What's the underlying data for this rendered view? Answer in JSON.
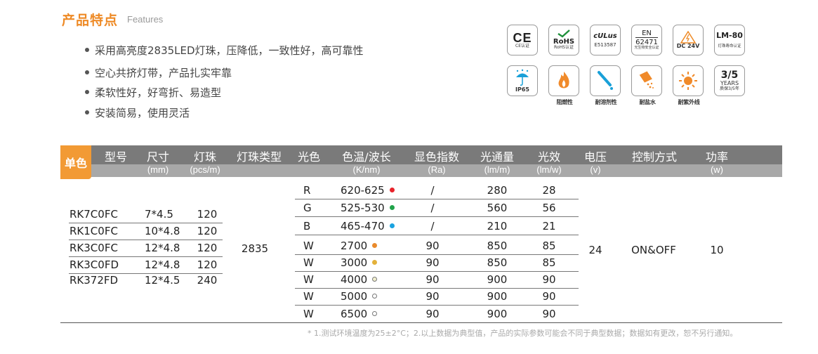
{
  "header": {
    "title": "产品特点",
    "title_en": "Features"
  },
  "features": [
    "采用高亮度2835LED灯珠，压降低，一致性好，高可靠性",
    "空心共挤灯带，产品扎实牢靠",
    "柔软性好，好弯折、易造型",
    "安装简易，使用灵活"
  ],
  "certs_row1": [
    {
      "main": "CE",
      "caption": "CE认证",
      "icon": "ce-mark-icon"
    },
    {
      "main": "RoHS",
      "caption": "RoHS认证",
      "icon": "rohs-check-icon"
    },
    {
      "main": "cULus",
      "caption": "E513587",
      "icon": "ul-mark-icon"
    },
    {
      "top": "EN",
      "main": "62471",
      "caption": "光生物安全认证",
      "icon": "en-standard-icon"
    },
    {
      "main": "DC 24V",
      "icon": "voltage-warning-icon"
    },
    {
      "main": "LM-80",
      "caption": "灯珠寿命认证",
      "icon": "lm80-icon"
    }
  ],
  "certs_row2": [
    {
      "caption": "IP65",
      "icon": "umbrella-rain-icon"
    },
    {
      "caption": "阻燃性",
      "icon": "flame-icon"
    },
    {
      "caption": "耐溶剂性",
      "icon": "dropper-icon"
    },
    {
      "caption": "耐盐水",
      "icon": "salt-water-icon"
    },
    {
      "caption": "耐紫外线",
      "icon": "sun-icon"
    },
    {
      "main": "3/5",
      "sub": "YEARS",
      "caption": "质保3/5年",
      "icon": "warranty-icon"
    }
  ],
  "table": {
    "tab_label": "单色",
    "headers": [
      {
        "label": "型号",
        "unit": ""
      },
      {
        "label": "尺寸",
        "unit": "(mm)"
      },
      {
        "label": "灯珠",
        "unit": "(pcs/m)"
      },
      {
        "label": "灯珠类型",
        "unit": ""
      },
      {
        "label": "光色",
        "unit": ""
      },
      {
        "label": "色温/波长",
        "unit": "(K/nm)"
      },
      {
        "label": "显色指数",
        "unit": "(Ra)"
      },
      {
        "label": "光通量",
        "unit": "(lm/m)"
      },
      {
        "label": "光效",
        "unit": "(lm/w)"
      },
      {
        "label": "电压",
        "unit": "(v)"
      },
      {
        "label": "控制方式",
        "unit": ""
      },
      {
        "label": "功率",
        "unit": "(w)"
      }
    ],
    "models": [
      {
        "model": "RK7C0FC",
        "size": "7*4.5",
        "leds": "120"
      },
      {
        "model": "RK1C0FC",
        "size": "10*4.8",
        "leds": "120"
      },
      {
        "model": "RK3C0FC",
        "size": "12*4.8",
        "leds": "120"
      },
      {
        "model": "RK3C0FD",
        "size": "12*4.8",
        "leds": "120"
      },
      {
        "model": "RK372FD",
        "size": "12*4.5",
        "leds": "240"
      }
    ],
    "led_type": "2835",
    "voltage": "24",
    "control": "ON&OFF",
    "power": "10",
    "colors": [
      {
        "color": "R",
        "cct": "620-625",
        "dot": "#e8232a",
        "ra": "/",
        "flux": "280",
        "eff": "28"
      },
      {
        "color": "G",
        "cct": "525-530",
        "dot": "#21a34a",
        "ra": "/",
        "flux": "560",
        "eff": "56"
      },
      {
        "color": "B",
        "cct": "465-470",
        "dot": "#1aa3e0",
        "ra": "/",
        "flux": "210",
        "eff": "21"
      },
      {
        "color": "W",
        "cct": "2700",
        "dot": "#e98a2c",
        "ra": "90",
        "flux": "850",
        "eff": "85"
      },
      {
        "color": "W",
        "cct": "3000",
        "dot": "#e3b13a",
        "ra": "90",
        "flux": "850",
        "eff": "85"
      },
      {
        "color": "W",
        "cct": "4000",
        "dot": "#f2f0cf",
        "ra": "90",
        "flux": "900",
        "eff": "90"
      },
      {
        "color": "W",
        "cct": "5000",
        "dot": "#ffffff",
        "ra": "90",
        "flux": "900",
        "eff": "90"
      },
      {
        "color": "W",
        "cct": "6500",
        "dot": "#ffffff",
        "ra": "90",
        "flux": "900",
        "eff": "90"
      }
    ]
  },
  "footnote": "* 1.测试环境温度为25±2°C；2.以上数据为典型值，产品的实际参数可能会不同于典型数据；数据如有更改，恕不另行通知。"
}
